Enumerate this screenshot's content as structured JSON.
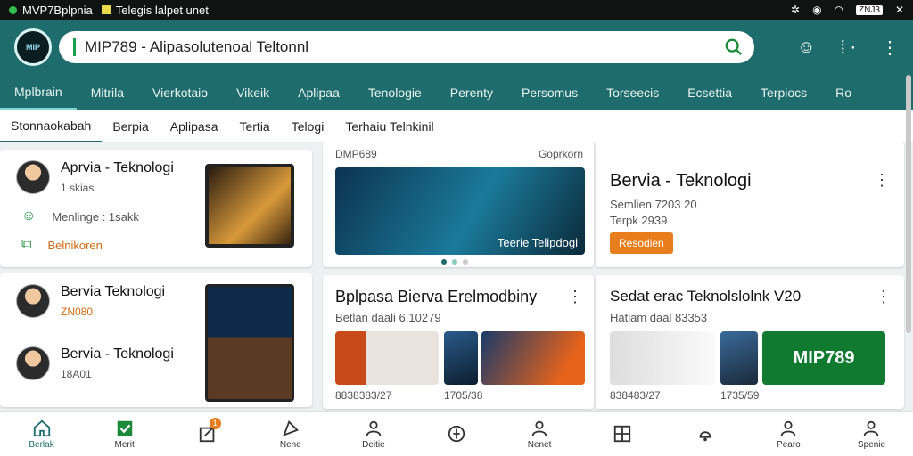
{
  "status": {
    "app1": "MVP7Bplpnia",
    "app2": "Telegis lalpet unet",
    "battery": "ZNJ3"
  },
  "header": {
    "search_value": "MIP789 - Alipasolutenoal Teltonnl",
    "logo_text": "MIP"
  },
  "tabs": [
    "Mplbrain",
    "Mitrila",
    "Vierkotaio",
    "Vikeik",
    "Aplipaa",
    "Tenologie",
    "Perenty",
    "Persomus",
    "Torseecis",
    "Ecsettia",
    "Terpiocs",
    "Ro"
  ],
  "subtabs": [
    "Stonnaokabah",
    "Berpia",
    "Aplipasa",
    "Tertia",
    "Telogi",
    "Terhaiu Telnkinil"
  ],
  "left": {
    "item1": {
      "title": "Aprvia - Teknologi",
      "sub": "1 skias"
    },
    "item2": {
      "label": "Menlinge : 1sakk"
    },
    "item3": {
      "label": "Belnikoren"
    },
    "item4": {
      "title": "Bervia Teknologi",
      "sub": "ZN080"
    },
    "item5": {
      "title": "Bervia - Teknologi",
      "sub": "18A01"
    }
  },
  "featured": {
    "label_left": "DMP689",
    "label_right": "Goprkorn",
    "caption": "Teerie Telipdogi"
  },
  "right_card": {
    "title": "Bervia - Teknologi",
    "line1": "Semlien 7203 20",
    "line2": "Terpk 2939",
    "button": "Resodien"
  },
  "card_b": {
    "title": "Bplpasa Bierva Erelmodbiny",
    "sub": "Betlan daali 6.10279",
    "foot_left": "8838383/27",
    "foot_right": "1705/38"
  },
  "card_c": {
    "title": "Sedat erac Teknolslolnk V20",
    "sub": "Hatlam daal 83353",
    "foot_left": "838483/27",
    "foot_right": "1735/59",
    "promo": "MIP789"
  },
  "bottom_nav": [
    {
      "label": "Berlak",
      "icon": "home-icon"
    },
    {
      "label": "Merit",
      "icon": "check-square-icon"
    },
    {
      "label": "",
      "icon": "edit-icon",
      "badge": "1"
    },
    {
      "label": "Nene",
      "icon": "send-icon"
    },
    {
      "label": "Deitie",
      "icon": "user-icon"
    },
    {
      "label": "",
      "icon": "compass-icon"
    },
    {
      "label": "Nenet",
      "icon": "person-icon"
    },
    {
      "label": "",
      "icon": "grid-icon"
    },
    {
      "label": "",
      "icon": "bell-icon"
    },
    {
      "label": "Pearo",
      "icon": "profile-icon"
    },
    {
      "label": "Spenie",
      "icon": "account-icon"
    }
  ],
  "colors": {
    "primary": "#1f6c6c",
    "accent": "#e77d1c",
    "promo": "#0f7a30"
  }
}
